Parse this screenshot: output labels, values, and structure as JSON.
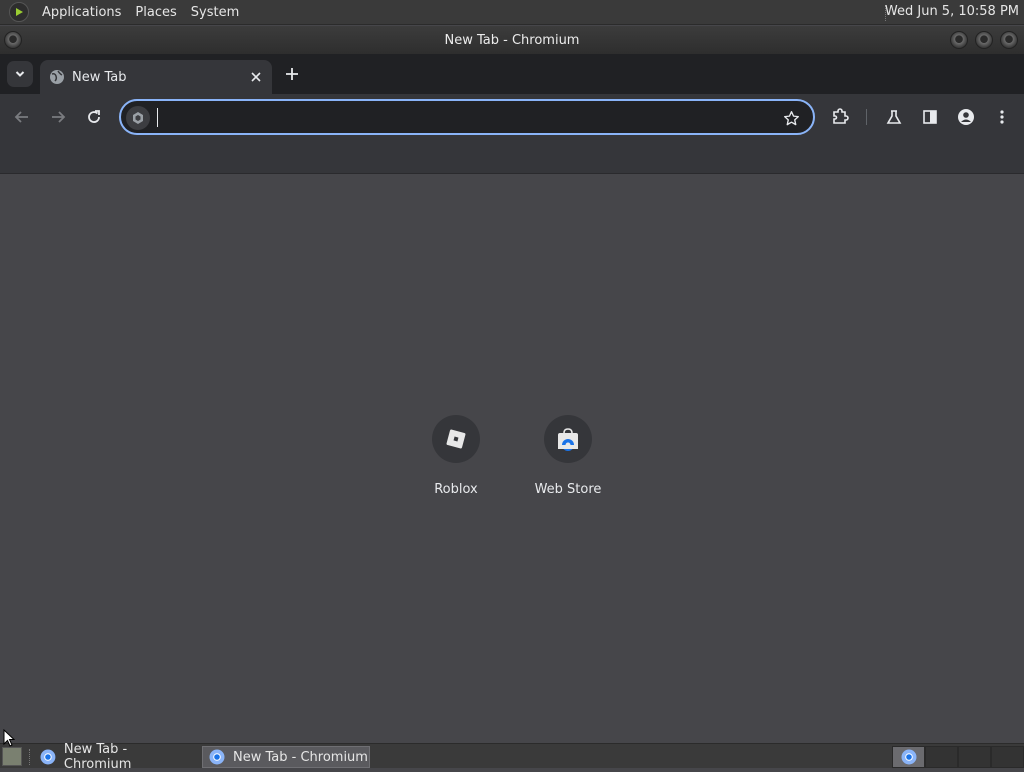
{
  "top_panel": {
    "menus": [
      "Applications",
      "Places",
      "System"
    ],
    "clock": "Wed Jun  5, 10:58 PM"
  },
  "window": {
    "title": "New Tab - Chromium"
  },
  "tabs": [
    {
      "title": "New Tab",
      "icon": "globe-icon"
    }
  ],
  "toolbar": {
    "address_value": "",
    "icons": [
      "back-icon",
      "forward-icon",
      "reload-icon",
      "site-info-icon",
      "bookmark-star-icon",
      "extensions-icon",
      "labs-icon",
      "side-panel-icon",
      "profile-icon",
      "menu-icon"
    ]
  },
  "shortcuts": [
    {
      "label": "Roblox",
      "icon": "roblox-icon"
    },
    {
      "label": "Web Store",
      "icon": "web-store-icon"
    }
  ],
  "taskbar": {
    "tasks": [
      {
        "label": "New Tab - Chromium",
        "active": false
      },
      {
        "label": "New Tab - Chromium",
        "active": true
      }
    ]
  },
  "colors": {
    "accent": "#8ab4f8",
    "content_bg": "#46464a",
    "toolbar_bg": "#35363a",
    "tabstrip_bg": "#202124"
  }
}
